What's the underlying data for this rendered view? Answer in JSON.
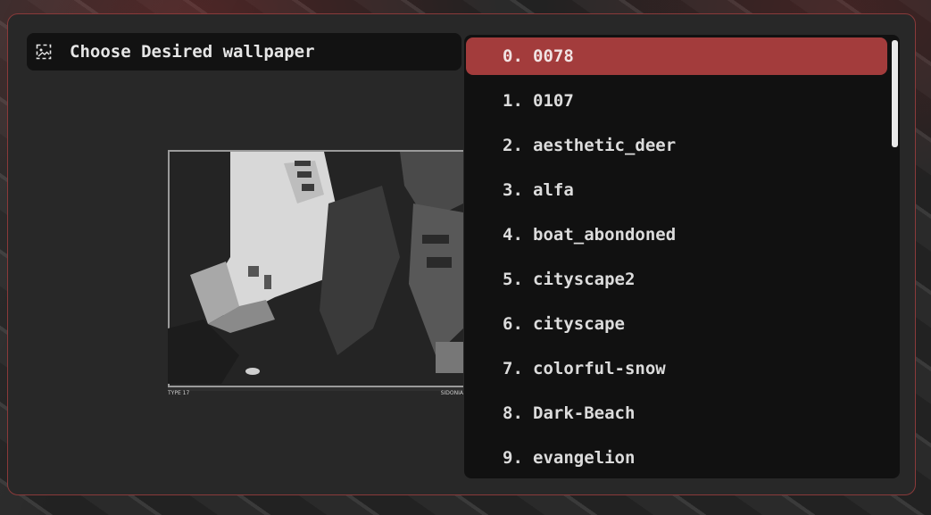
{
  "prompt": {
    "icon": "image-icon",
    "text": "Choose Desired wallpaper"
  },
  "preview": {
    "caption_left": "TYPE 17",
    "caption_right": "SIDONIA"
  },
  "list": {
    "selected_index": 0,
    "items": [
      {
        "index": "0.",
        "name": "0078"
      },
      {
        "index": "1.",
        "name": "0107"
      },
      {
        "index": "2.",
        "name": "aesthetic_deer"
      },
      {
        "index": "3.",
        "name": "alfa"
      },
      {
        "index": "4.",
        "name": "boat_abondoned"
      },
      {
        "index": "5.",
        "name": "cityscape2"
      },
      {
        "index": "6.",
        "name": "cityscape"
      },
      {
        "index": "7.",
        "name": "colorful-snow"
      },
      {
        "index": "8.",
        "name": "Dark-Beach"
      },
      {
        "index": "9.",
        "name": "evangelion"
      }
    ]
  },
  "colors": {
    "selected_bg": "#a33c3c",
    "panel_bg": "#111111",
    "window_bg": "#282828",
    "border": "#8a3a3a"
  }
}
